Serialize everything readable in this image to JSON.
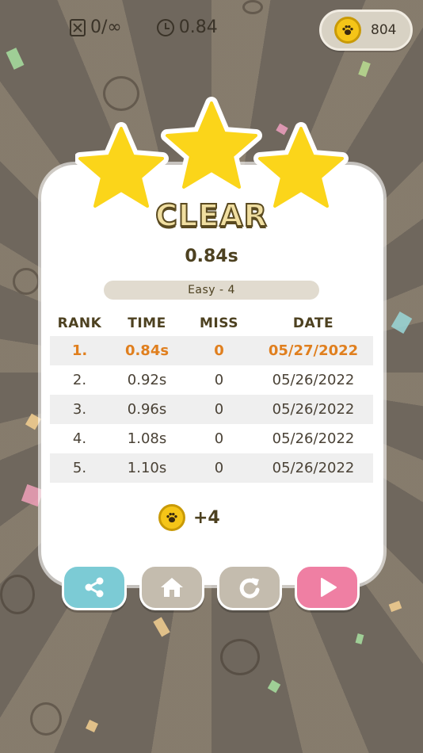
{
  "hud": {
    "miss_counter": "0/∞",
    "time": "0.84",
    "coins": "804"
  },
  "result": {
    "title": "CLEAR",
    "time": "0.84s",
    "level": "Easy - 4",
    "stars_earned": 3
  },
  "table": {
    "headers": [
      "RANK",
      "TIME",
      "MISS",
      "DATE"
    ],
    "rows": [
      {
        "rank": "1.",
        "time": "0.84s",
        "miss": "0",
        "date": "05/27/2022"
      },
      {
        "rank": "2.",
        "time": "0.92s",
        "miss": "0",
        "date": "05/26/2022"
      },
      {
        "rank": "3.",
        "time": "0.96s",
        "miss": "0",
        "date": "05/26/2022"
      },
      {
        "rank": "4.",
        "time": "1.08s",
        "miss": "0",
        "date": "05/26/2022"
      },
      {
        "rank": "5.",
        "time": "1.10s",
        "miss": "0",
        "date": "05/26/2022"
      }
    ]
  },
  "reward": {
    "amount": "+4"
  },
  "colors": {
    "star": "#fbd51a",
    "highlight": "#e07f1e",
    "share": "#7ccbd5",
    "home": "#c4bcae",
    "retry": "#c4bcae",
    "next": "#ef7fa3"
  },
  "icons": {
    "miss": "miss-box-icon",
    "clock": "clock-icon",
    "coin": "paw-coin-icon",
    "share": "share-icon",
    "home": "home-icon",
    "retry": "retry-icon",
    "next": "play-icon"
  }
}
